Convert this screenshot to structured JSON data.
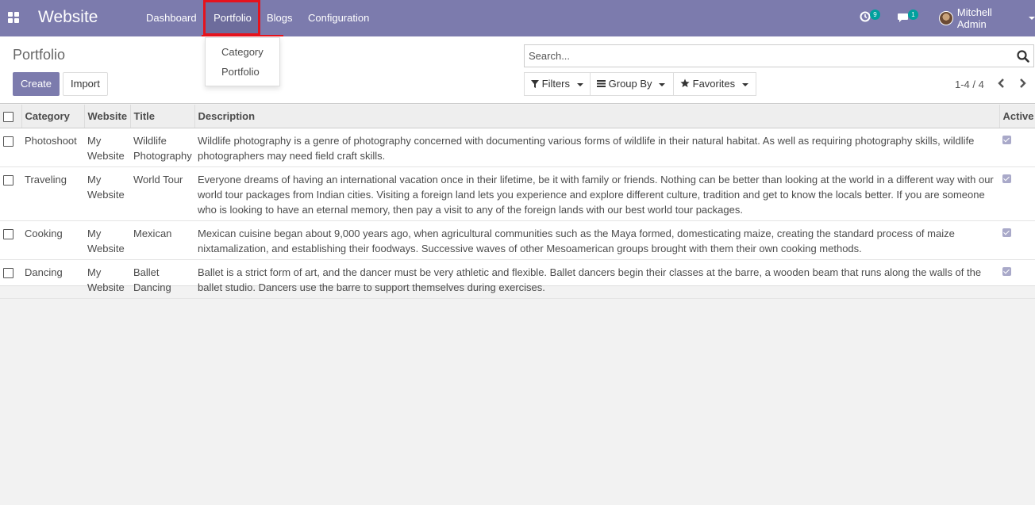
{
  "navbar": {
    "brand": "Website",
    "menu": [
      "Dashboard",
      "Portfolio",
      "Blogs",
      "Configuration"
    ],
    "activity_count": "9",
    "message_count": "1",
    "user_name": "Mitchell Admin"
  },
  "dropdown": {
    "items": [
      "Category",
      "Portfolio"
    ]
  },
  "control_panel": {
    "title": "Portfolio",
    "create_label": "Create",
    "import_label": "Import",
    "search_placeholder": "Search...",
    "filters_label": "Filters",
    "group_by_label": "Group By",
    "favorites_label": "Favorites",
    "pager": "1-4 / 4"
  },
  "table": {
    "headers": [
      "Category",
      "Website",
      "Title",
      "Description",
      "Active"
    ],
    "rows": [
      {
        "category": "Photoshoot",
        "website": "My Website",
        "title": "Wildlife Photography",
        "description": "Wildlife photography is a genre of photography concerned with documenting various forms of wildlife in their natural habitat. As well as requiring photography skills, wildlife photographers may need field craft skills.",
        "active": true
      },
      {
        "category": "Traveling",
        "website": "My Website",
        "title": "World Tour",
        "description": "Everyone dreams of having an international vacation once in their lifetime, be it with family or friends. Nothing can be better than looking at the world in a different way with our world tour packages from Indian cities. Visiting a foreign land lets you experience and explore different culture, tradition and get to know the locals better. If you are someone who is looking to have an eternal memory, then pay a visit to any of the foreign lands with our best world tour packages.",
        "active": true
      },
      {
        "category": "Cooking",
        "website": "My Website",
        "title": "Mexican",
        "description": "Mexican cuisine began about 9,000 years ago, when agricultural communities such as the Maya formed, domesticating maize, creating the standard process of maize nixtamalization, and establishing their foodways. Successive waves of other Mesoamerican groups brought with them their own cooking methods.",
        "active": true
      },
      {
        "category": "Dancing",
        "website": "My Website",
        "title": "Ballet Dancing",
        "description": "Ballet is a strict form of art, and the dancer must be very athletic and flexible. Ballet dancers begin their classes at the barre, a wooden beam that runs along the walls of the ballet studio. Dancers use the barre to support themselves during exercises.",
        "active": true
      }
    ]
  },
  "colors": {
    "navbar": "#7c7bad",
    "highlight": "#e5131d",
    "badge": "#00a09d"
  }
}
